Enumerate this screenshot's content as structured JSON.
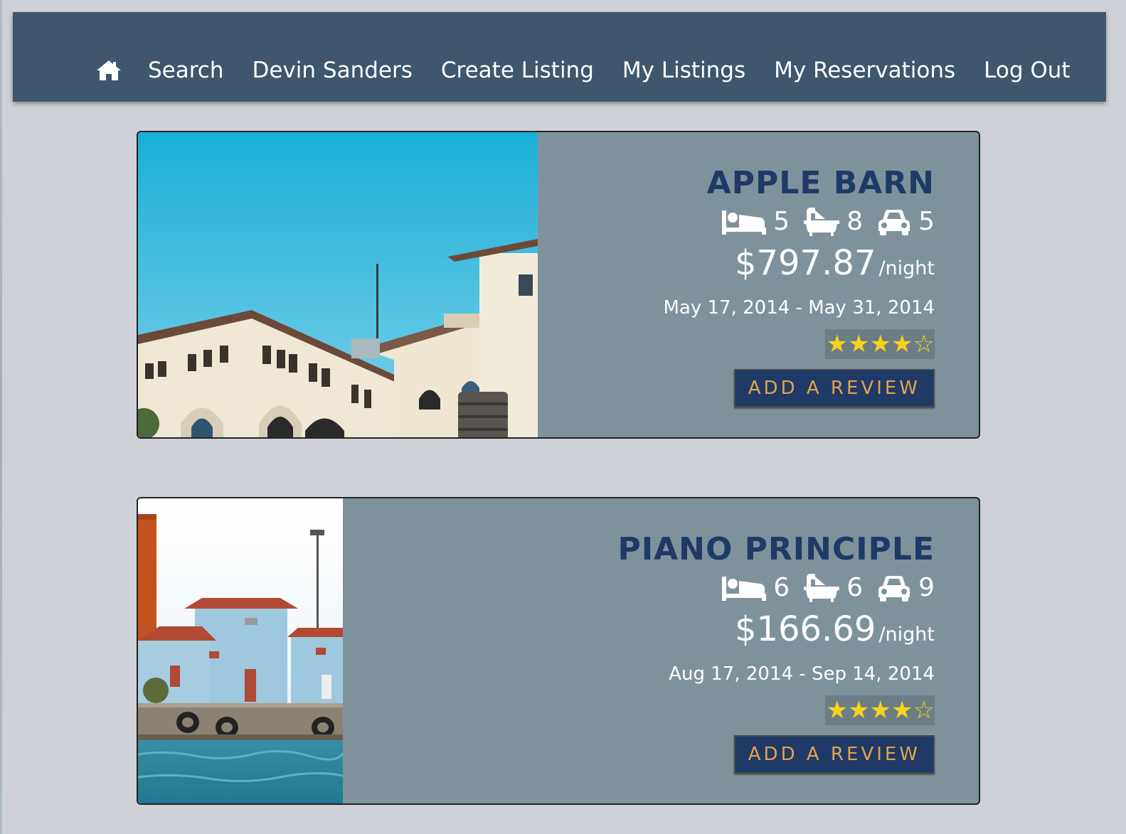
{
  "nav": {
    "home_icon": "home-icon",
    "items": [
      "Search",
      "Devin Sanders",
      "Create Listing",
      "My Listings",
      "My Reservations",
      "Log Out"
    ]
  },
  "listings": [
    {
      "title": "APPLE BARN",
      "beds": "5",
      "baths": "8",
      "parking": "5",
      "price": "$797.87",
      "per": "/night",
      "dates": "May 17, 2014 - May 31, 2014",
      "rating": 4,
      "rating_max": 5,
      "review_label": "ADD A REVIEW"
    },
    {
      "title": "PIANO PRINCIPLE",
      "beds": "6",
      "baths": "6",
      "parking": "9",
      "price": "$166.69",
      "per": "/night",
      "dates": "Aug 17, 2014 - Sep 14, 2014",
      "rating": 4,
      "rating_max": 5,
      "review_label": "ADD A REVIEW"
    }
  ],
  "icons": {
    "beds": "bed-icon",
    "baths": "bathtub-icon",
    "parking": "car-icon"
  },
  "colors": {
    "nav_bg": "#3f566d",
    "card_bg": "#7f929c",
    "title": "#1f3a66",
    "button_bg": "#1f3a66",
    "button_text": "#e6a24e",
    "star": "#f7d21c"
  }
}
